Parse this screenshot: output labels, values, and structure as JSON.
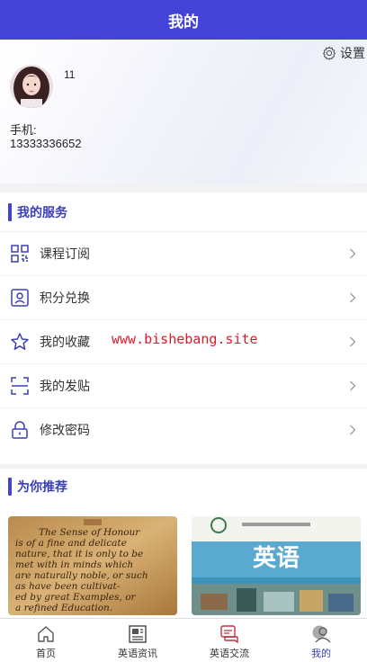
{
  "header": {
    "title": "我的"
  },
  "profile": {
    "settings_label": "设置",
    "username": "11",
    "phone_label": "手机:",
    "phone_value": "13333336652"
  },
  "services": {
    "title": "我的服务",
    "items": [
      {
        "label": "课程订阅",
        "icon": "grid-icon"
      },
      {
        "label": "积分兑换",
        "icon": "badge-icon"
      },
      {
        "label": "我的收藏",
        "icon": "star-icon"
      },
      {
        "label": "我的发贴",
        "icon": "scan-icon"
      },
      {
        "label": "修改密码",
        "icon": "lock-icon"
      }
    ]
  },
  "watermark": "www.bishebang.site",
  "recommend": {
    "title": "为你推荐",
    "left_card": {
      "lines": [
        "The Sense of Honour",
        "is of a fine and delicate",
        "nature, that it is only to be",
        "met with in minds which",
        "are naturally noble, or such",
        "as have been cultivat-",
        "ed by great Examples, or",
        "a refined Education."
      ]
    },
    "right_card": {
      "title": "英语"
    }
  },
  "tabbar": {
    "tabs": [
      {
        "label": "首页",
        "icon": "home-icon"
      },
      {
        "label": "英语资讯",
        "icon": "news-icon"
      },
      {
        "label": "英语交流",
        "icon": "chat-icon"
      },
      {
        "label": "我的",
        "icon": "user-icon"
      }
    ],
    "active_index": 3
  },
  "colors": {
    "primary": "#4343d8",
    "section_title": "#3b3fb5",
    "watermark": "#e0192a"
  }
}
